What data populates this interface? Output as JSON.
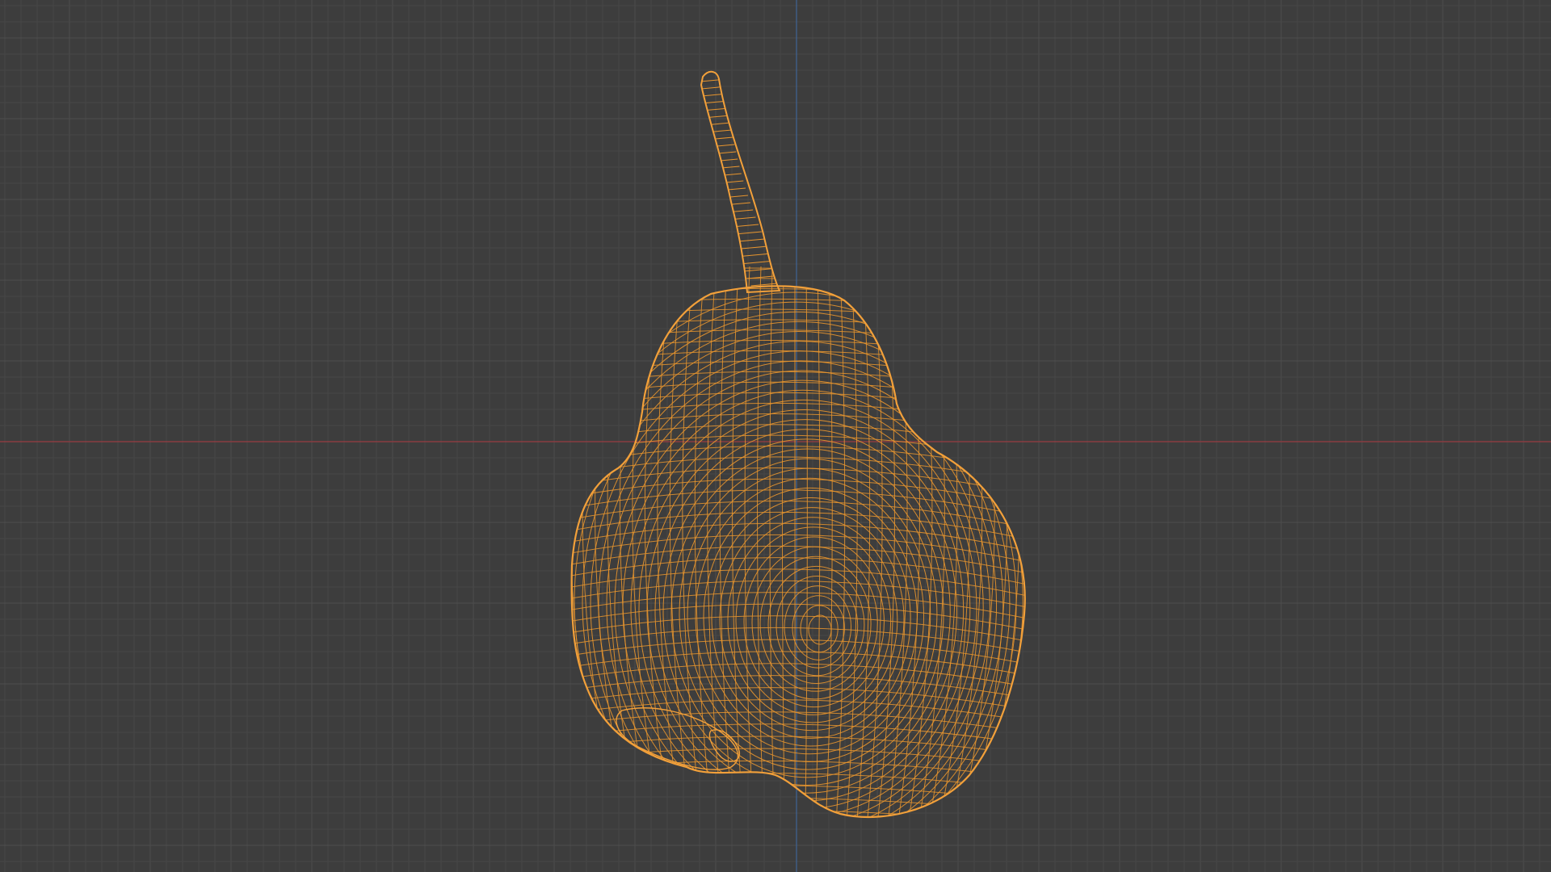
{
  "viewport": {
    "background_color": "#3d3d3d",
    "grid_minor_color": "#474747",
    "grid_major_color": "#4d4d4d",
    "x_axis_color": "#8a3d42",
    "y_axis_color": "#3f5f8a",
    "shading_mode": "wireframe"
  },
  "object": {
    "kind": "pear-mesh",
    "selected": true,
    "wire_color": "#e8952e",
    "outline_color": "#f2a03a"
  }
}
